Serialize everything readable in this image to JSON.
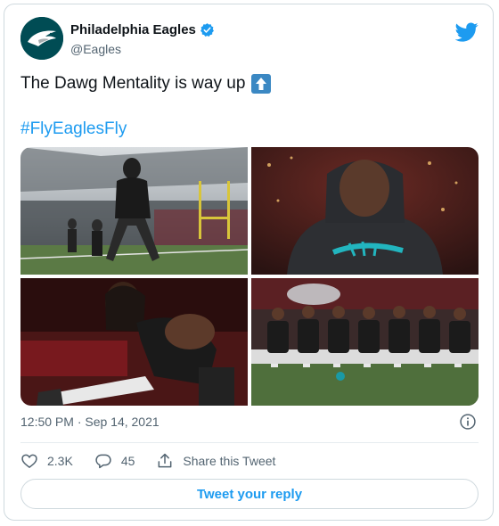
{
  "account": {
    "name": "Philadelphia Eagles",
    "handle": "@Eagles"
  },
  "tweet": {
    "text": "The Dawg Mentality is way up",
    "emoji": "up-arrow-emoji",
    "hashtag": "#FlyEaglesFly",
    "timestamp": "12:50 PM · Sep 14, 2021"
  },
  "photos": [
    {
      "name": "player-training-on-field-photo"
    },
    {
      "name": "player-in-hoodie-looking-up-photo"
    },
    {
      "name": "player-stretching-photo"
    },
    {
      "name": "players-seated-on-bench-photo"
    }
  ],
  "actions": {
    "likes": "2.3K",
    "replies": "45",
    "share_label": "Share this Tweet"
  },
  "reply_button": "Tweet your reply",
  "colors": {
    "accent": "#1d9bf0",
    "eagles_green": "#004c54"
  }
}
